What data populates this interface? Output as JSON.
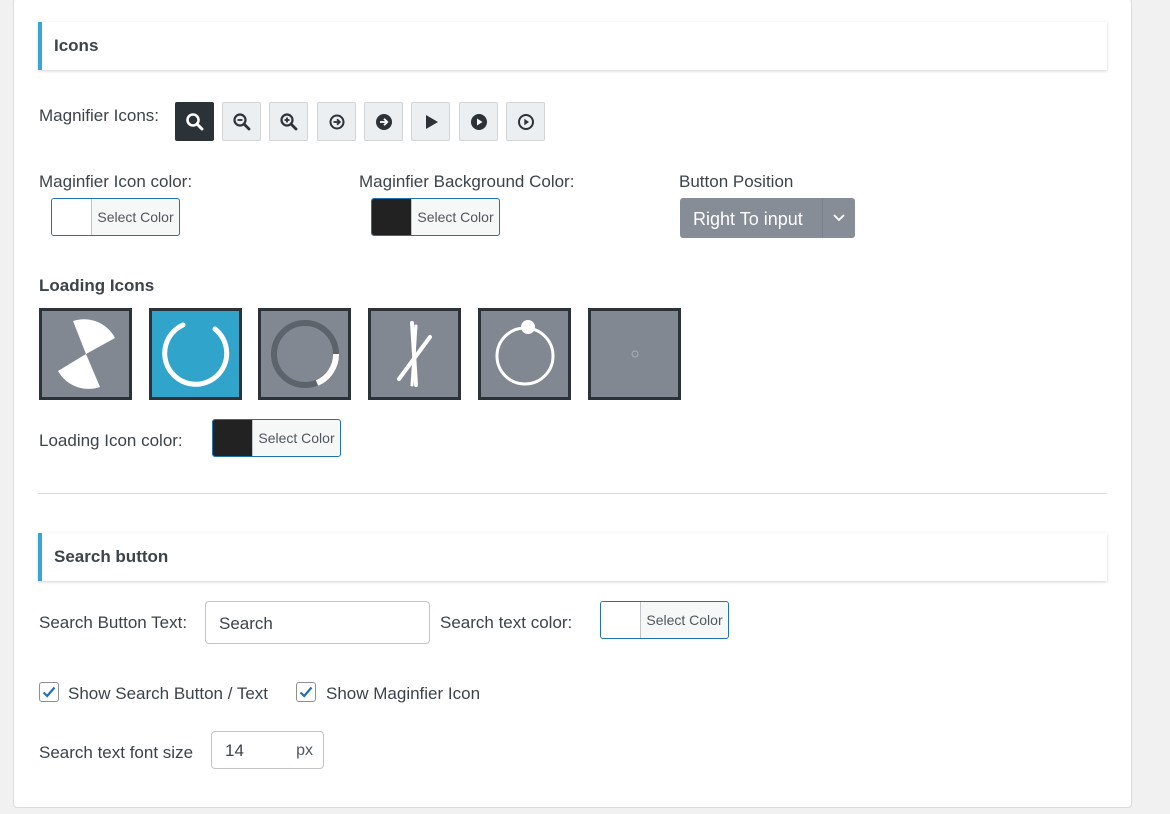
{
  "icons_section": {
    "title": "Icons",
    "magnifier_label": "Magnifier Icons:",
    "magnifier_icons": [
      "search-icon",
      "zoom-out-icon",
      "zoom-in-icon",
      "arrow-circle-outline-icon",
      "arrow-circle-filled-icon",
      "play-icon",
      "play-circle-filled-icon",
      "play-circle-outline-icon"
    ],
    "icon_color_label": "Maginfier Icon color:",
    "icon_color_button": "Select Color",
    "icon_color_value": "#ffffff",
    "bg_color_label": "Maginfier Background Color:",
    "bg_color_button": "Select Color",
    "bg_color_value": "#222222",
    "button_position_label": "Button Position",
    "button_position_value": "Right To input",
    "loading_icons_label": "Loading Icons",
    "loading_icons": [
      "pie-spinner-icon",
      "ring-spinner-icon",
      "dual-ring-spinner-icon",
      "cross-lines-spinner-icon",
      "orbit-spinner-icon",
      "dot-spinner-icon"
    ],
    "loading_icon_color_label": "Loading Icon color:",
    "loading_icon_color_button": "Select Color",
    "loading_icon_color_value": "#222222"
  },
  "search_section": {
    "title": "Search button",
    "button_text_label": "Search Button Text:",
    "button_text_value": "Search",
    "text_color_label": "Search text color:",
    "text_color_button": "Select Color",
    "text_color_value": "#ffffff",
    "show_button_label": "Show Search Button / Text",
    "show_button_checked": true,
    "show_icon_label": "Show Maginfier Icon",
    "show_icon_checked": true,
    "font_size_label": "Search text font size",
    "font_size_value": "14",
    "font_size_unit": "px"
  },
  "colors": {
    "accent": "#3aa4d4",
    "check": "#2271b1",
    "active_loader": "#31a4cc"
  }
}
